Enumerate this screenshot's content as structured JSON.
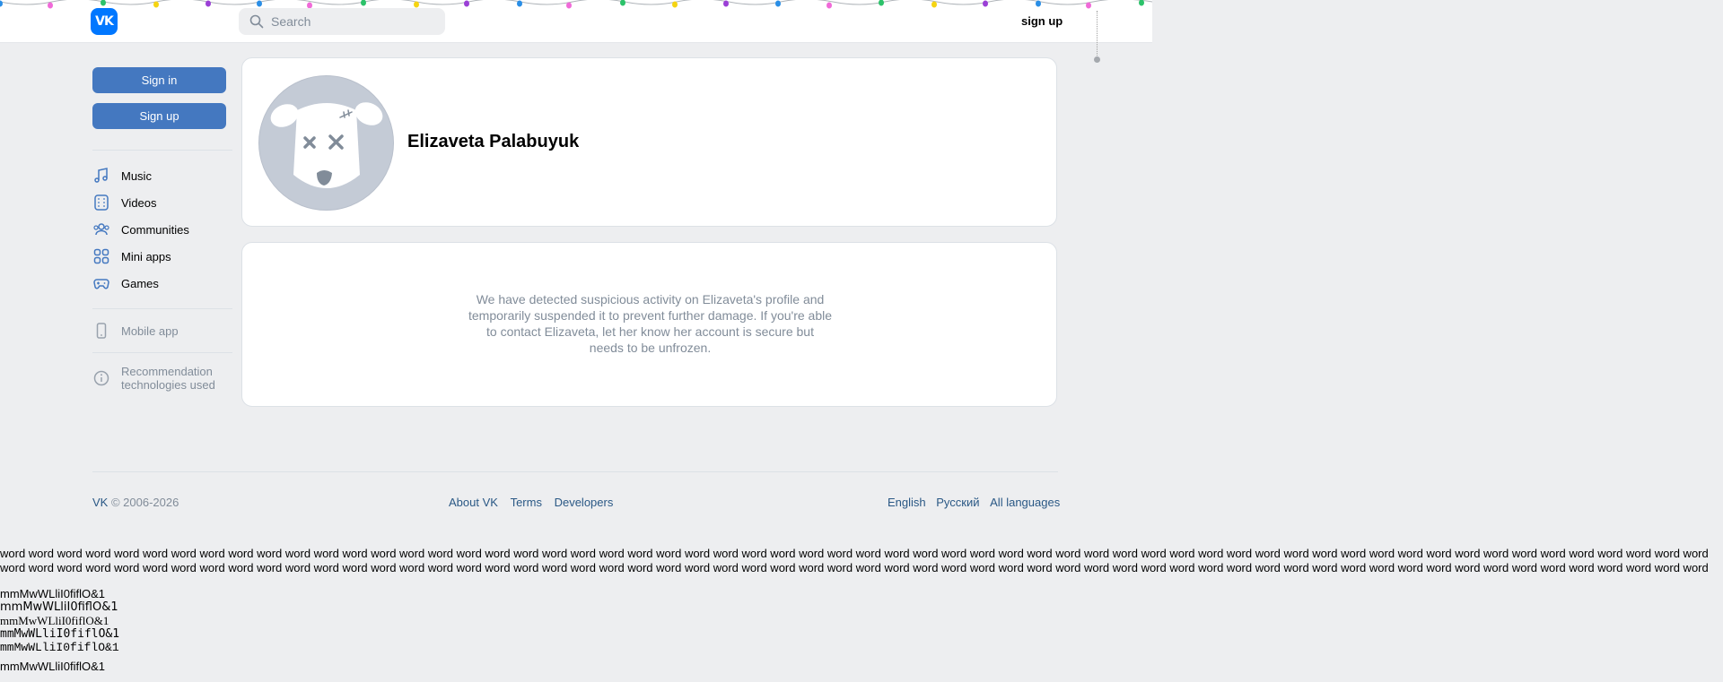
{
  "header": {
    "logo_text": "VK",
    "search_placeholder": "Search",
    "signup_link": "sign up"
  },
  "sidebar": {
    "sign_in": "Sign in",
    "sign_up": "Sign up",
    "items": [
      {
        "label": "Music",
        "icon": "music-note-icon"
      },
      {
        "label": "Videos",
        "icon": "video-film-icon"
      },
      {
        "label": "Communities",
        "icon": "users-icon"
      },
      {
        "label": "Mini apps",
        "icon": "grid-icon"
      },
      {
        "label": "Games",
        "icon": "gamepad-icon"
      }
    ],
    "mobile_app": "Mobile app",
    "recommendation": "Recommendation technologies used"
  },
  "profile": {
    "name": "Elizaveta Palabuyuk",
    "notice": "We have detected suspicious activity on Elizaveta's profile and temporarily suspended it to prevent further damage. If you're able to contact Elizaveta, let her know her account is secure but needs to be unfrozen."
  },
  "footer": {
    "brand": "VK",
    "copyright": "© 2006-2026",
    "links": [
      "About VK",
      "Terms",
      "Developers"
    ],
    "languages": [
      "English",
      "Русский",
      "All languages"
    ]
  },
  "font_test": {
    "words": "word word word word word word word word word word word word word word word word word word word word word word word word word word word word word word word word word word word word word word word word word word word word word word word word word word word word word word word word word word word word word word word word word word word word word word word word word word word word word word word word word word word word word word word word word word word word word word word word word word word word word word word word word word word word word word word word word word word word word word word word word word word word word word word word word word",
    "lines": [
      "mmMwWLliI0fiflO&1",
      "mmMwWLliI0fiflO&1",
      "mmMwWLliI0fiflO&1",
      "mmMwWLliI0fiflO&1",
      "mmMwWLliI0fiflO&1",
      "mmMwWLliI0fiflO&1"
    ]
  },
  "colors": {
    "accent": "#4478c0",
    "logo": "#0077ff",
    "link": "#2a5885",
    "muted": "#818c99",
    "page_bg": "#edeef0"
  }
}
